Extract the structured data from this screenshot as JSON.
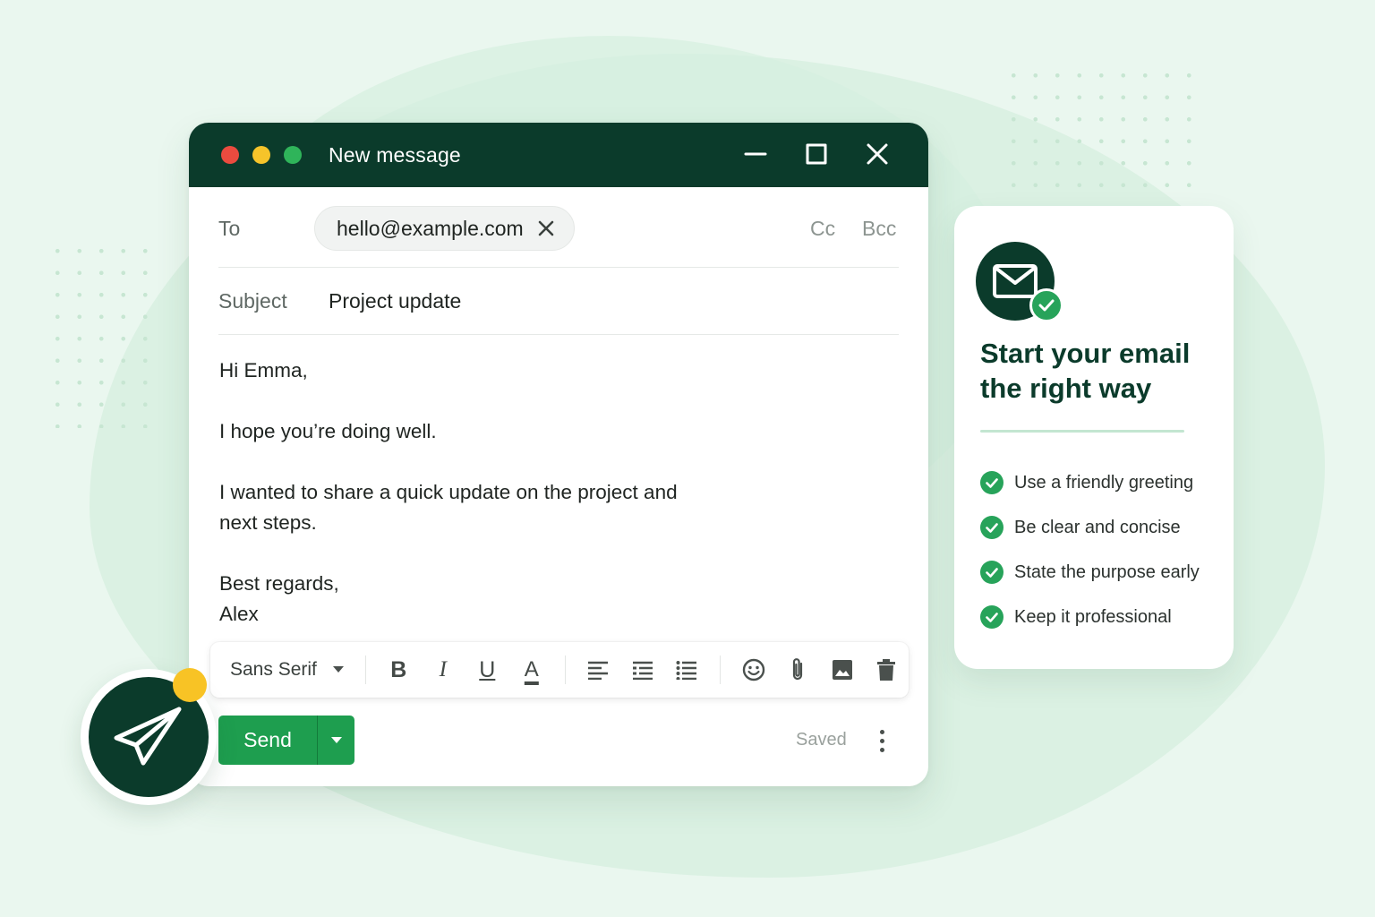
{
  "window": {
    "title": "New message",
    "controls": [
      "minimize-icon",
      "maximize-icon",
      "close-icon"
    ]
  },
  "to": {
    "label": "To",
    "recipient": "hello@example.com",
    "cc_label": "Cc",
    "bcc_label": "Bcc"
  },
  "subject": {
    "label": "Subject",
    "value": "Project update"
  },
  "body": {
    "greeting": "Hi Emma,",
    "line1": "I hope you’re doing well.",
    "line2a": "I wanted to share a quick update on the project and",
    "line2b": "next steps.",
    "closing": "Best regards,",
    "signature": "Alex"
  },
  "toolbar": {
    "font": "Sans Serif",
    "buttons": [
      "bold-icon",
      "italic-icon",
      "underline-icon",
      "text-color-icon",
      "align-left-icon",
      "numbered-list-icon",
      "bulleted-list-icon",
      "emoji-icon",
      "attach-icon",
      "image-icon",
      "trash-icon"
    ],
    "bold": "B",
    "italic": "I",
    "underline": "U",
    "text_color": "A"
  },
  "footer": {
    "send_label": "Send",
    "status": "Saved"
  },
  "tips_card": {
    "title_line1": "Start your email",
    "title_line2": "the right way",
    "items": [
      "Use a friendly greeting",
      "Be clear and concise",
      "State the purpose early",
      "Keep it professional"
    ]
  },
  "colors": {
    "brand_dark": "#0b3b2b",
    "accent_green": "#1e9e4f",
    "accent_yellow": "#f8c325",
    "background": "#eaf7ef"
  }
}
